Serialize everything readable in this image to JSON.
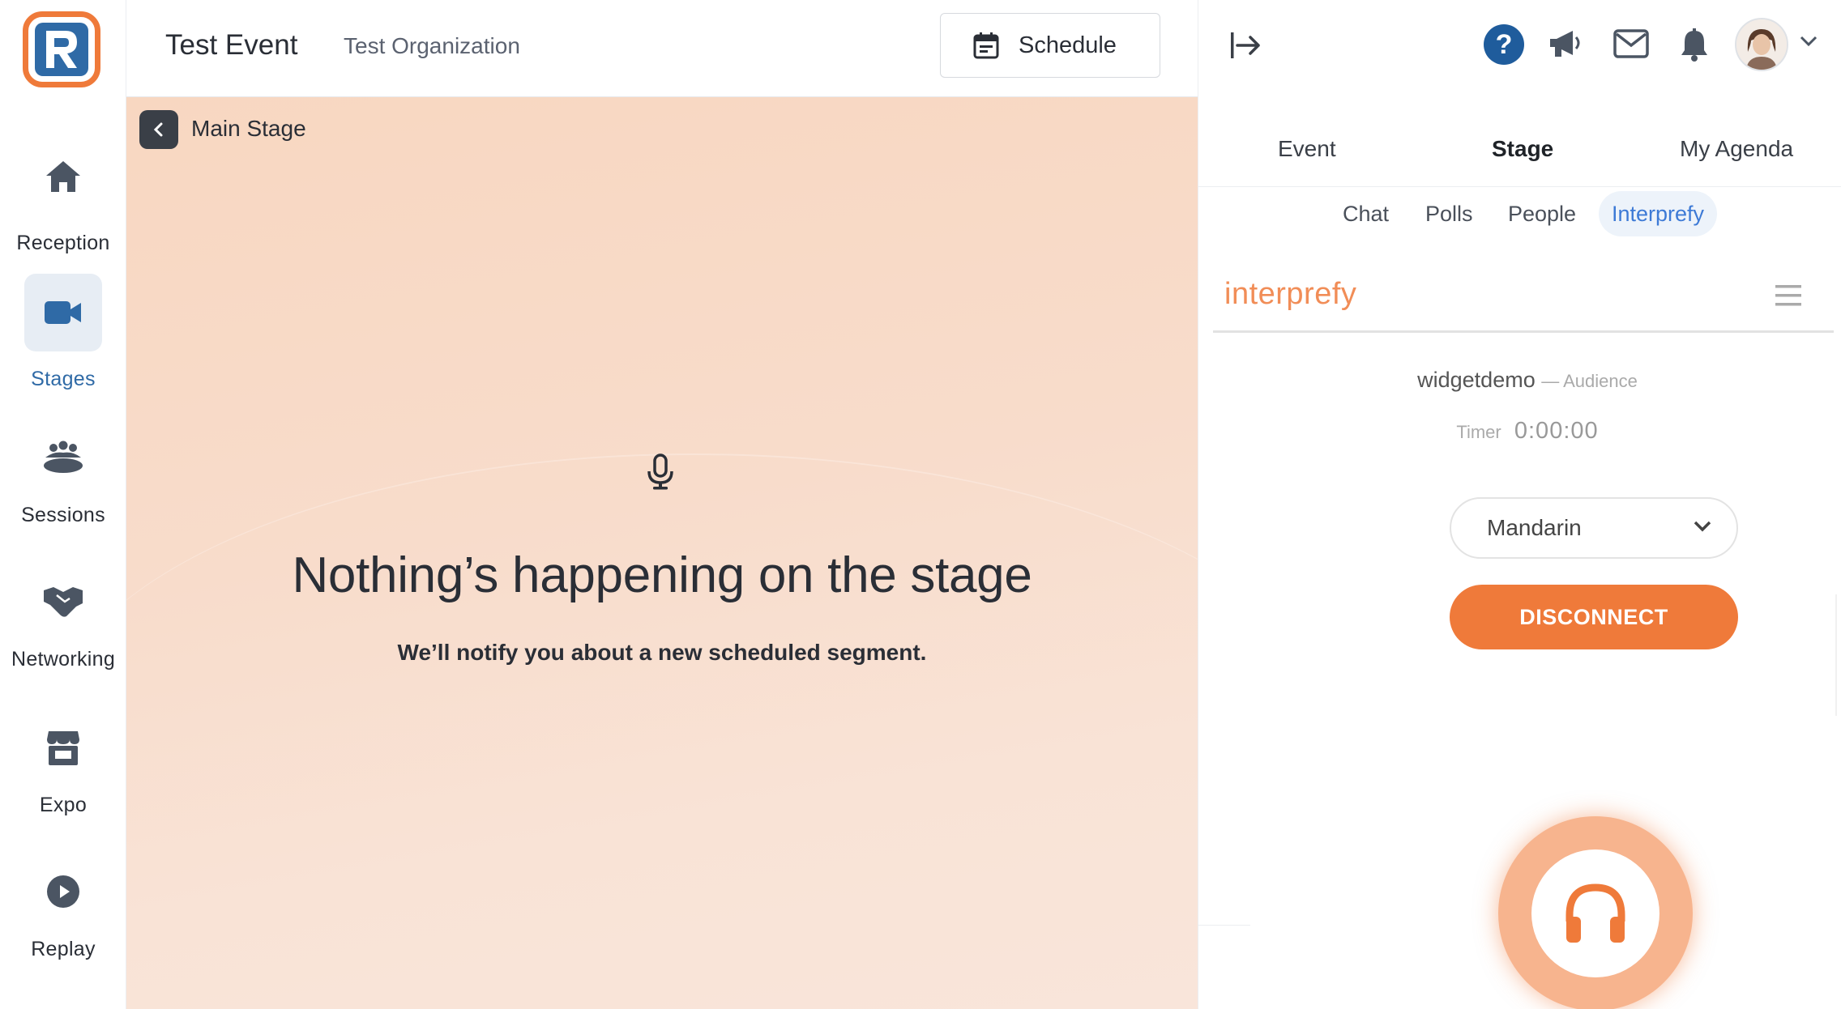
{
  "nav": {
    "items": [
      {
        "label": "Reception",
        "icon": "home-icon"
      },
      {
        "label": "Stages",
        "icon": "video-camera-icon",
        "active": true
      },
      {
        "label": "Sessions",
        "icon": "group-icon"
      },
      {
        "label": "Networking",
        "icon": "handshake-icon"
      },
      {
        "label": "Expo",
        "icon": "booth-icon"
      },
      {
        "label": "Replay",
        "icon": "play-icon"
      }
    ]
  },
  "header": {
    "event_title": "Test Event",
    "organization": "Test Organization",
    "schedule_label": "Schedule"
  },
  "stage": {
    "name": "Main Stage",
    "empty_title": "Nothing’s happening on the stage",
    "empty_subtitle": "We’ll notify you about a new scheduled segment."
  },
  "panel": {
    "tabs": [
      "Event",
      "Stage",
      "My Agenda"
    ],
    "active_tab": "Stage",
    "subtabs": [
      "Chat",
      "Polls",
      "People",
      "Interprefy"
    ],
    "active_subtab": "Interprefy"
  },
  "interprefy": {
    "brand": "interprefy",
    "room": "widgetdemo",
    "role": "— Audience",
    "timer_label": "Timer",
    "timer_value": "0:00:00",
    "language": "Mandarin",
    "disconnect_label": "DISCONNECT"
  },
  "colors": {
    "accent_blue": "#2f6aa6",
    "help_blue": "#1f5c9c",
    "interprefy_orange": "#ef7a3a",
    "stage_bg": "#f8d9c6"
  }
}
